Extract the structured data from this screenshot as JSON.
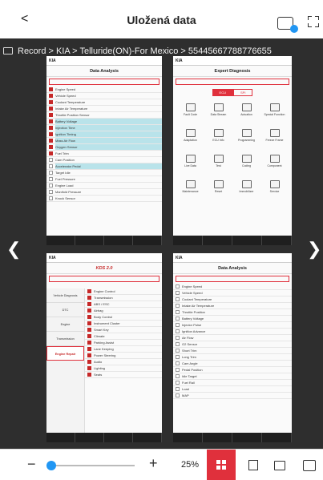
{
  "header": {
    "title": "Uložená data",
    "back_glyph": "<"
  },
  "breadcrumb": "Record > KIA > Telluride(ON)-For Mexico > 55445667788776655",
  "panes": {
    "top_left": {
      "brand": "KIA",
      "screen_title": "Data Analysis",
      "rows": [
        "Engine Speed",
        "Vehicle Speed",
        "Coolant Temperature",
        "Intake Air Temperature",
        "Throttle Position Sensor",
        "Battery Voltage",
        "Injection Time",
        "Ignition Timing",
        "Mass Air Flow",
        "Oxygen Sensor",
        "Fuel Trim",
        "Cam Position",
        "Accelerator Pedal",
        "Target Idle",
        "Fuel Pressure",
        "Engine Load",
        "Manifold Pressure",
        "Knock Sensor"
      ]
    },
    "top_right": {
      "screen_title": "Expert Diagnosis",
      "tabs": [
        "ECU",
        "SPI"
      ],
      "tiles": [
        "Fault Code",
        "Data Stream",
        "Actuation",
        "Special Function",
        "Adaptation",
        "ECU Info",
        "Programming",
        "Freeze Frame",
        "Live Data",
        "Test",
        "Coding",
        "Component",
        "Maintenance",
        "Reset",
        "Immobilizer",
        "Service"
      ]
    },
    "bottom_left": {
      "screen_title": "KDS 2.0",
      "left_items": [
        "Vehicle Diagnosis",
        "DTC",
        "Engine",
        "Transmission",
        "Engine Repair"
      ],
      "rows": [
        "Engine Control",
        "Transmission",
        "ABS / ESC",
        "Airbag",
        "Body Control",
        "Instrument Cluster",
        "Smart Key",
        "Climate",
        "Parking Assist",
        "Lane Keeping",
        "Power Steering",
        "Audio",
        "Lighting",
        "Seats"
      ]
    },
    "bottom_right": {
      "screen_title": "Data Analysis",
      "rows": [
        "Engine Speed",
        "Vehicle Speed",
        "Coolant Temperature",
        "Intake Air Temperature",
        "Throttle Position",
        "Battery Voltage",
        "Injector Pulse",
        "Ignition Advance",
        "Air Flow",
        "O2 Sensor",
        "Short Trim",
        "Long Trim",
        "Cam Angle",
        "Pedal Position",
        "Idle Target",
        "Fuel Rail",
        "Load",
        "MAP"
      ]
    }
  },
  "toolbar": {
    "minus": "−",
    "plus": "+",
    "zoom_value": "25%",
    "slider_fraction": 0.04
  },
  "colors": {
    "accent": "#e0303c",
    "slider": "#2196f3",
    "viewer_bg": "#2e2e2e"
  },
  "icons": [
    "back-icon",
    "saved-data-icon",
    "fullscreen-icon",
    "folder-icon",
    "grid-layout-icon",
    "single-page-icon",
    "info-icon",
    "print-icon"
  ]
}
